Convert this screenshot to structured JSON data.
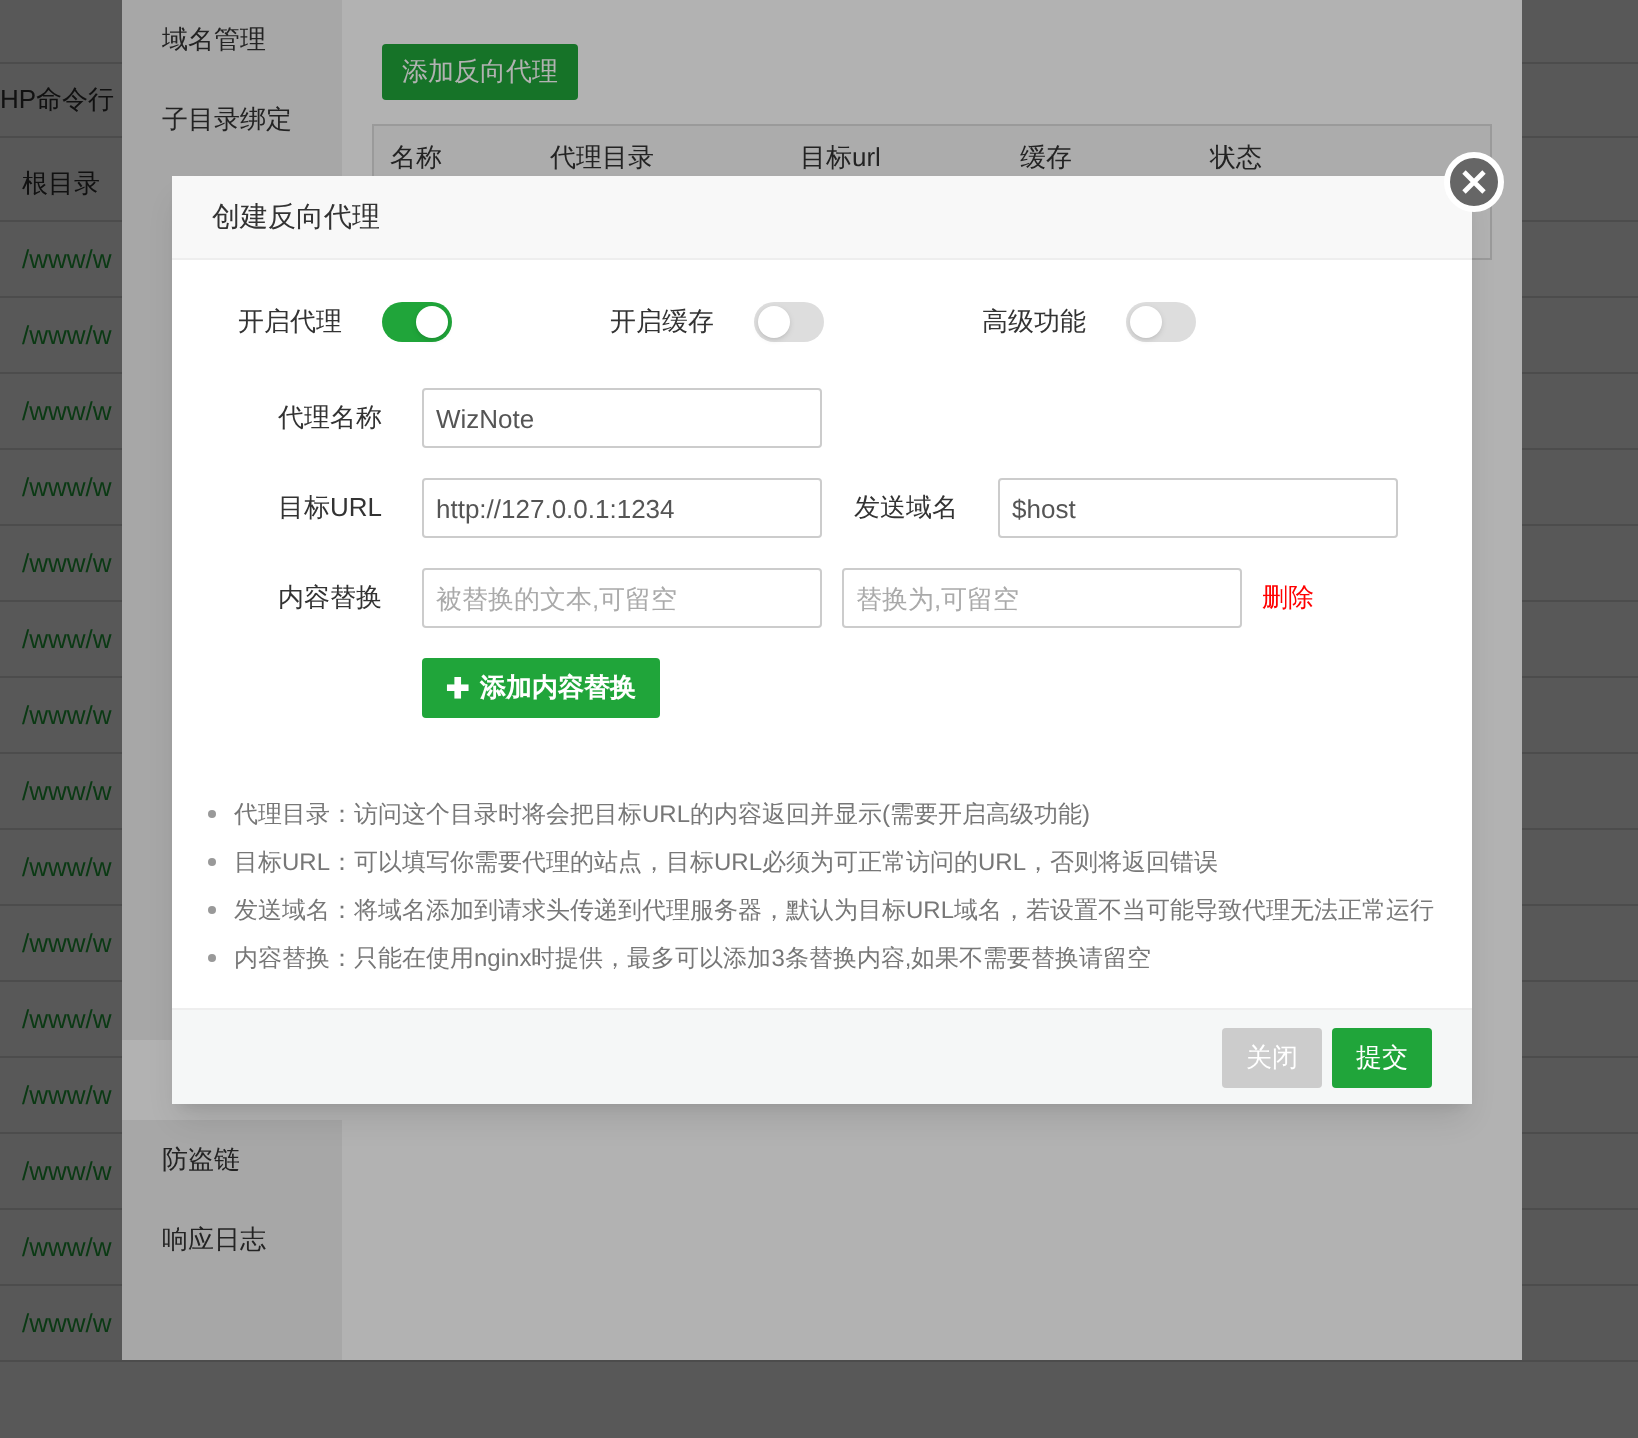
{
  "background_page": {
    "top_cell": "HP命令行",
    "column_header": "根目录",
    "rows": [
      "/www/w",
      "/www/w",
      "/www/w",
      "/www/w",
      "/www/w",
      "/www/w",
      "/www/w",
      "/www/w",
      "/www/w",
      "/www/w",
      "/www/w",
      "/www/w",
      "/www/w",
      "/www/w",
      "/www/w"
    ]
  },
  "settings_panel": {
    "sidebar": {
      "items_top": [
        "域名管理",
        "子目录绑定"
      ],
      "items_bottom": [
        "防盗链",
        "响应日志"
      ]
    },
    "add_button": "添加反向代理",
    "table": {
      "columns": [
        "名称",
        "代理目录",
        "目标url",
        "缓存",
        "状态"
      ]
    }
  },
  "dialog": {
    "title": "创建反向代理",
    "toggles": [
      {
        "label": "开启代理",
        "on": true
      },
      {
        "label": "开启缓存",
        "on": false
      },
      {
        "label": "高级功能",
        "on": false
      }
    ],
    "proxy_name": {
      "label": "代理名称",
      "value": "WizNote"
    },
    "target_url": {
      "label": "目标URL",
      "value": "http://127.0.0.1:1234"
    },
    "send_domain": {
      "label": "发送域名",
      "value": "$host"
    },
    "content_replace": {
      "label": "内容替换",
      "from_placeholder": "被替换的文本,可留空",
      "to_placeholder": "替换为,可留空",
      "delete_link": "删除"
    },
    "add_replace_button": {
      "icon": "✚",
      "label": "添加内容替换"
    },
    "notes": [
      "代理目录：访问这个目录时将会把目标URL的内容返回并显示(需要开启高级功能)",
      "目标URL：可以填写你需要代理的站点，目标URL必须为可正常访问的URL，否则将返回错误",
      "发送域名：将域名添加到请求头传递到代理服务器，默认为目标URL域名，若设置不当可能导致代理无法正常运行",
      "内容替换：只能在使用nginx时提供，最多可以添加3条替换内容,如果不需要替换请留空"
    ],
    "buttons": {
      "close": "关闭",
      "submit": "提交"
    }
  }
}
